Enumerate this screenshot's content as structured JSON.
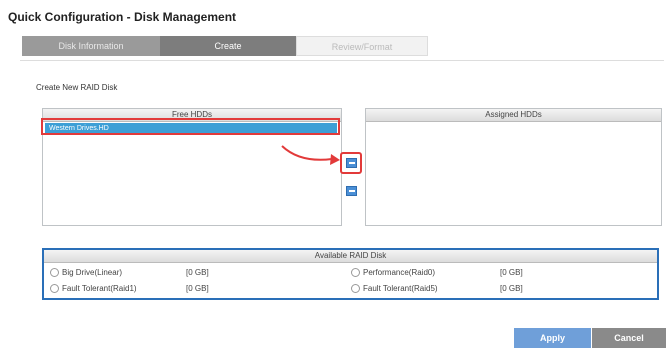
{
  "page": {
    "title": "Quick Configuration - Disk Management"
  },
  "steps": [
    {
      "label": "Disk Information"
    },
    {
      "label": "Create"
    },
    {
      "label": "Review/Format"
    }
  ],
  "section": {
    "title": "Create New RAID Disk"
  },
  "free_hdds": {
    "header": "Free HDDs",
    "items": [
      "Western Drives.HD"
    ]
  },
  "assigned_hdds": {
    "header": "Assigned HDDs",
    "items": []
  },
  "raid": {
    "header": "Available RAID Disk",
    "options": [
      {
        "label": "Big Drive(Linear)",
        "size": "[0 GB]"
      },
      {
        "label": "Performance(Raid0)",
        "size": "[0 GB]"
      },
      {
        "label": "Fault Tolerant(Raid1)",
        "size": "[0 GB]"
      },
      {
        "label": "Fault Tolerant(Raid5)",
        "size": "[0 GB]"
      }
    ]
  },
  "buttons": {
    "apply": "Apply",
    "cancel": "Cancel"
  },
  "colors": {
    "accent": "#3d9fd6",
    "highlight": "#e23a3a",
    "raid_border": "#2a6fb8"
  }
}
